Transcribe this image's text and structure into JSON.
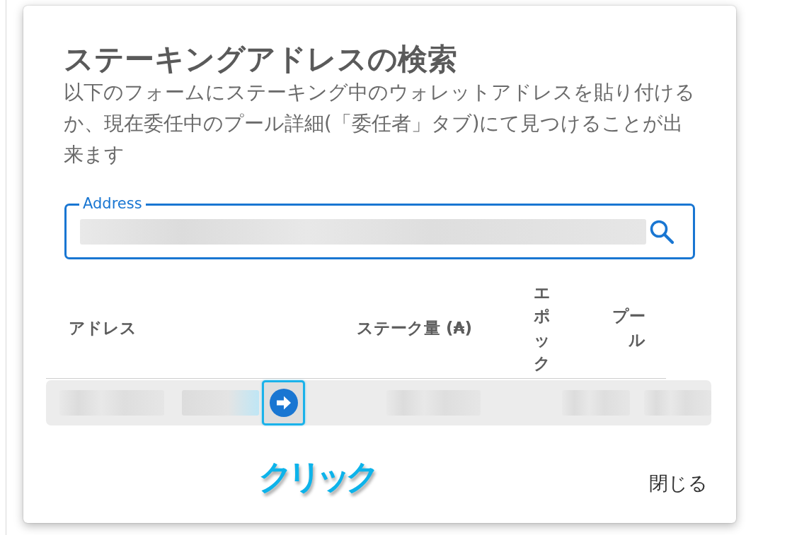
{
  "dialog": {
    "title": "ステーキングアドレスの検索",
    "description": "以下のフォームにステーキング中のウォレットアドレスを貼り付けるか、現在委任中のプール詳細(「委任者」タブ)にて見つけることが出来ます",
    "address_field": {
      "label": "Address",
      "focused": true
    },
    "table": {
      "columns": [
        {
          "label": "アドレス"
        },
        {
          "label": "ステーク量 (₳)"
        },
        {
          "label": "エポック"
        },
        {
          "label": "プール"
        }
      ],
      "rows": [
        {
          "kind": "redacted",
          "highlighted": true
        }
      ]
    },
    "annotation": {
      "text": "クリック"
    },
    "close_button": {
      "label": "閉じる"
    }
  }
}
